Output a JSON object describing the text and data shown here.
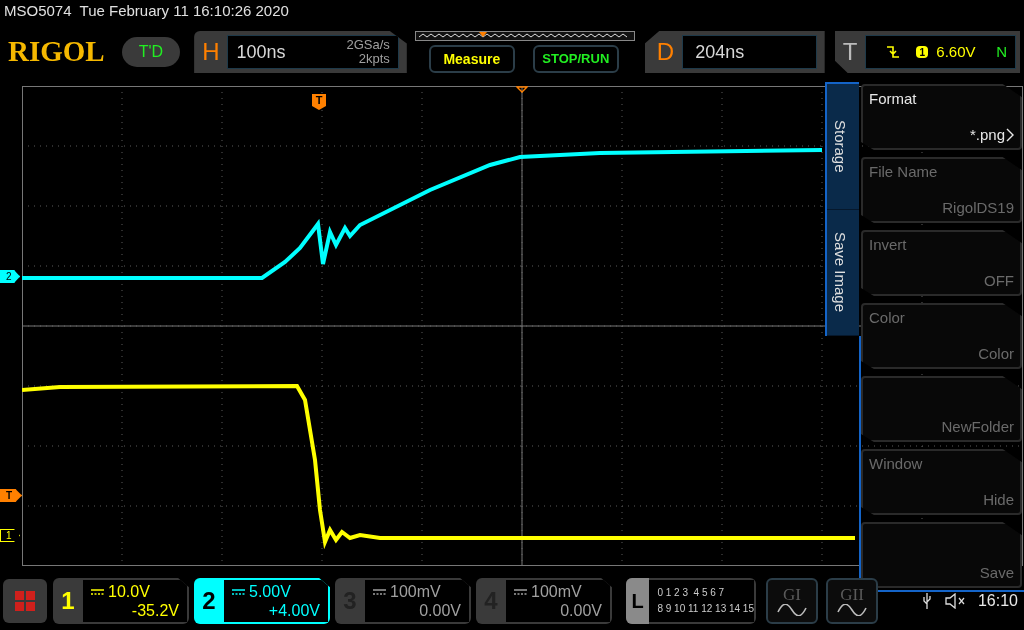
{
  "header": {
    "model": "MSO5074",
    "datetime": "Tue February 11 16:10:26 2020"
  },
  "logo": "RIGOL",
  "run_state": "T'D",
  "horizontal": {
    "letter": "H",
    "timebase": "100ns",
    "sample_rate": "2GSa/s",
    "memory_depth": "2kpts"
  },
  "buttons": [
    {
      "label": "Measure",
      "kind": "measure"
    },
    {
      "label": "STOP/RUN",
      "kind": "run"
    }
  ],
  "delay": {
    "letter": "D",
    "value": "204ns"
  },
  "trigger": {
    "letter": "T",
    "source": "1",
    "level": "6.60V",
    "mode": "N"
  },
  "trigger_position_marker": "T",
  "level_markers": [
    {
      "label": "2",
      "kind": "channel",
      "color": "#00ffff"
    },
    {
      "label": "T",
      "kind": "trigger",
      "color": "#ff8000"
    },
    {
      "label": "1",
      "kind": "channel",
      "color": "#ffff00"
    }
  ],
  "menu": {
    "tabs": [
      "Storage",
      "Save Image"
    ],
    "items": [
      {
        "label": "Format",
        "value": "*.png",
        "disabled": false,
        "submenu": true
      },
      {
        "label": "File Name",
        "value": "RigolDS19",
        "disabled": true,
        "submenu": false
      },
      {
        "label": "Invert",
        "value": "OFF",
        "disabled": true,
        "submenu": false
      },
      {
        "label": "Color",
        "value": "Color",
        "disabled": true,
        "submenu": false
      },
      {
        "value": "NewFolder",
        "disabled": true,
        "submenu": false
      },
      {
        "label": "Window",
        "value": "Hide",
        "disabled": true,
        "submenu": false
      },
      {
        "value": "Save",
        "disabled": true,
        "submenu": false
      }
    ]
  },
  "channels": [
    {
      "number": "1",
      "scale": "10.0V",
      "offset": "-35.2V",
      "color": "#ffff00",
      "selected": false
    },
    {
      "number": "2",
      "scale": "5.00V",
      "offset": "+4.00V",
      "color": "#00ffff",
      "selected": true
    },
    {
      "number": "3",
      "scale": "100mV",
      "offset": "0.00V",
      "color": "#a0a0a0",
      "selected": false
    },
    {
      "number": "4",
      "scale": "100mV",
      "offset": "0.00V",
      "color": "#a0a0a0",
      "selected": false
    }
  ],
  "logic": {
    "letter": "L",
    "bits_row_1": "0 1 2 3  4 5 6 7",
    "bits_row_2": "8 9 10 11 12 13 14 15"
  },
  "generators": [
    "GI",
    "GII"
  ],
  "status": {
    "time": "16:10"
  }
}
